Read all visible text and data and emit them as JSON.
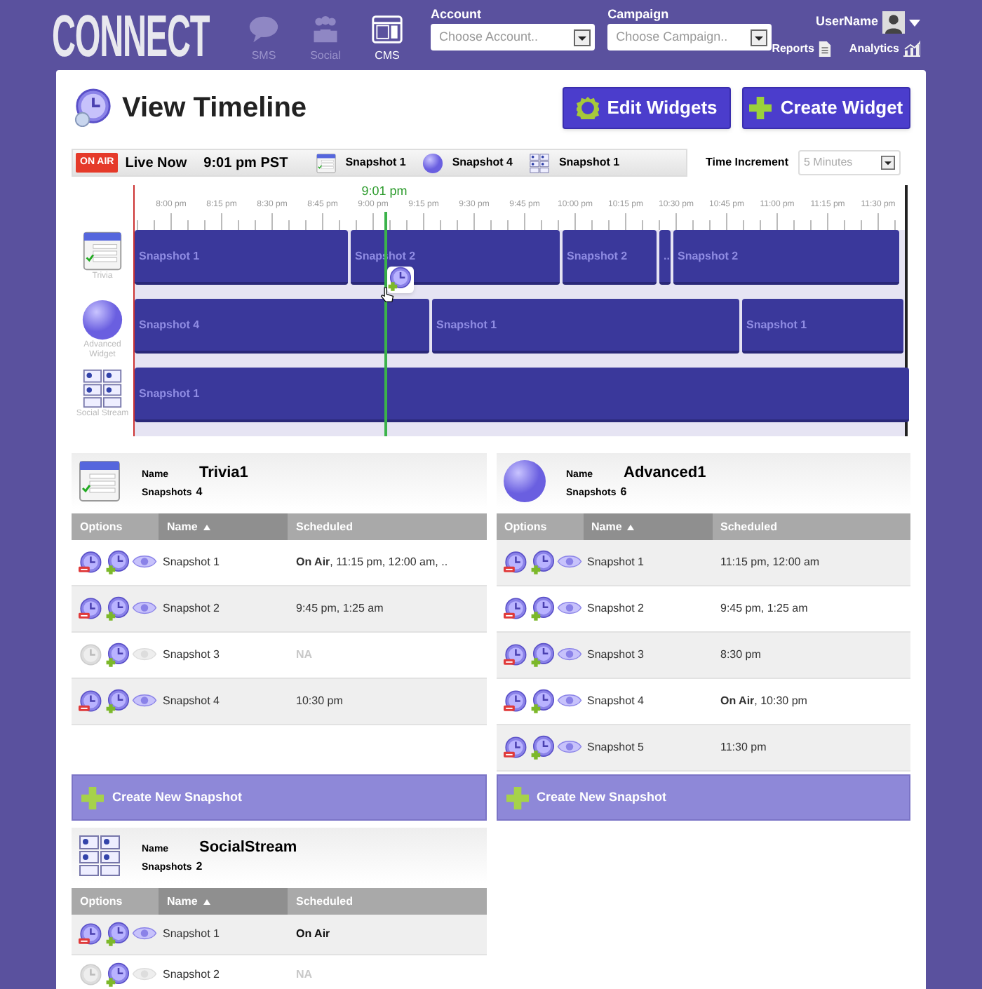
{
  "header": {
    "logo": "CONNECT",
    "nav": [
      {
        "label": "SMS",
        "kind": "sms",
        "selected": false
      },
      {
        "label": "Social",
        "kind": "social",
        "selected": false
      },
      {
        "label": "CMS",
        "kind": "cms",
        "selected": true
      }
    ],
    "selects": [
      {
        "label": "Account",
        "placeholder": "Choose Account.."
      },
      {
        "label": "Campaign",
        "placeholder": "Choose Campaign.."
      }
    ],
    "user": "UserName",
    "links": [
      {
        "label": "Reports",
        "kind": "reports"
      },
      {
        "label": "Analytics",
        "kind": "analytics"
      }
    ]
  },
  "page": {
    "title": "View Timeline",
    "buttons": [
      {
        "label": "Edit Widgets",
        "kind": "edit"
      },
      {
        "label": "Create Widget",
        "kind": "create"
      }
    ]
  },
  "live_bar": {
    "badge": "ON AIR",
    "label": "Live Now",
    "time": "9:01 pm PST",
    "now_playing": [
      {
        "kind": "trivia",
        "label": "Snapshot 1"
      },
      {
        "kind": "advanced",
        "label": "Snapshot 4"
      },
      {
        "kind": "social",
        "label": "Snapshot 1"
      }
    ],
    "increment": {
      "label": "Time Increment",
      "value": "5 Minutes"
    }
  },
  "timeline": {
    "now_label": "9:01 pm",
    "ticks": [
      "8:00 pm",
      "8:15 pm",
      "8:30 pm",
      "8:45 pm",
      "9:00 pm",
      "9:15 pm",
      "9:30 pm",
      "9:45 pm",
      "10:00 pm",
      "10:15 pm",
      "10:30 pm",
      "10:45 pm",
      "11:00 pm",
      "11:15 pm",
      "11:30 pm"
    ],
    "tracks": [
      {
        "kind": "trivia",
        "label": "Trivia",
        "blocks": [
          "Snapshot 1",
          "Snapshot 2",
          "Snapshot 2",
          "..",
          "Snapshot 2"
        ]
      },
      {
        "kind": "advanced",
        "label": "Advanced Widget",
        "blocks": [
          "Snapshot 4",
          "Snapshot 1",
          "Snapshot 1"
        ]
      },
      {
        "kind": "social",
        "label": "Social Stream",
        "blocks": [
          "Snapshot 1"
        ]
      }
    ]
  },
  "widgets": [
    {
      "kind": "trivia",
      "name_label": "Name",
      "name": "Trivia1",
      "count_label": "Snapshots",
      "count": "4",
      "columns": [
        {
          "label": "Options",
          "sorted": false
        },
        {
          "label": "Name",
          "sorted": true
        },
        {
          "label": "Scheduled",
          "sorted": false
        }
      ],
      "rows": [
        {
          "name": "Snapshot 1",
          "scheduled": "**On Air**, 11:15 pm, 12:00 am, ..",
          "enabled": true,
          "live": false,
          "shaded": false
        },
        {
          "name": "Snapshot 2",
          "scheduled": "9:45 pm, 1:25 am",
          "enabled": true,
          "live": false,
          "shaded": true
        },
        {
          "name": "Snapshot 3",
          "scheduled": "NA",
          "enabled": false,
          "live": false,
          "shaded": false
        },
        {
          "name": "Snapshot 4",
          "scheduled": "10:30 pm",
          "enabled": true,
          "live": false,
          "shaded": true
        }
      ],
      "create": "Create New Snapshot"
    },
    {
      "kind": "advanced",
      "name_label": "Name",
      "name": "Advanced1",
      "count_label": "Snapshots",
      "count": "6",
      "columns": [
        {
          "label": "Options",
          "sorted": false
        },
        {
          "label": "Name",
          "sorted": true
        },
        {
          "label": "Scheduled",
          "sorted": false
        }
      ],
      "rows": [
        {
          "name": "Snapshot 1",
          "scheduled": "11:15 pm, 12:00 am",
          "enabled": true,
          "live": false,
          "shaded": true
        },
        {
          "name": "Snapshot 2",
          "scheduled": "9:45 pm, 1:25 am",
          "enabled": true,
          "live": false,
          "shaded": false
        },
        {
          "name": "Snapshot 3",
          "scheduled": "8:30 pm",
          "enabled": true,
          "live": false,
          "shaded": true
        },
        {
          "name": "Snapshot 4",
          "scheduled": "**On Air**, 10:30 pm",
          "enabled": true,
          "live": false,
          "shaded": false
        },
        {
          "name": "Snapshot 5",
          "scheduled": "11:30 pm",
          "enabled": true,
          "live": false,
          "shaded": true
        }
      ],
      "create": "Create New Snapshot"
    },
    {
      "kind": "social",
      "name_label": "Name",
      "name": "SocialStream",
      "count_label": "Snapshots",
      "count": "2",
      "columns": [
        {
          "label": "Options",
          "sorted": false
        },
        {
          "label": "Name",
          "sorted": true
        },
        {
          "label": "Scheduled",
          "sorted": false
        }
      ],
      "rows": [
        {
          "name": "Snapshot 1",
          "scheduled": "On Air",
          "enabled": true,
          "live": true,
          "shaded": true
        },
        {
          "name": "Snapshot 2",
          "scheduled": "NA",
          "enabled": false,
          "live": false,
          "shaded": false
        }
      ]
    }
  ]
}
